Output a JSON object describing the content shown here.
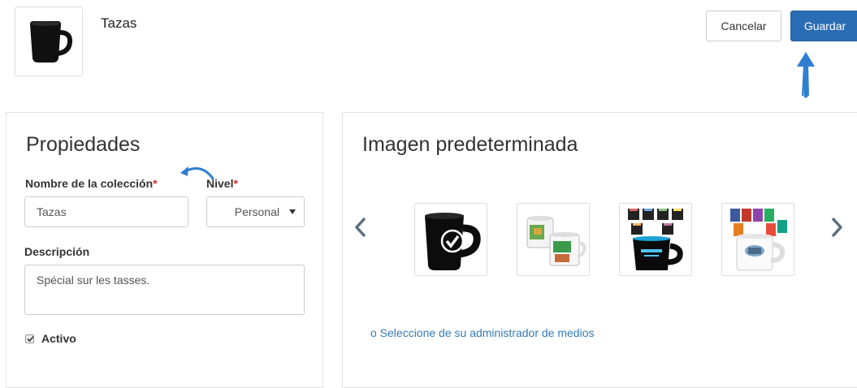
{
  "header": {
    "title": "Tazas",
    "thumbnail_icon": "black-mug-icon",
    "cancel_label": "Cancelar",
    "save_label": "Guardar"
  },
  "properties": {
    "heading": "Propiedades",
    "name_label": "Nombre de la colección",
    "name_value": "Tazas",
    "level_label": "Nivel",
    "level_value": "Personal",
    "required_marker": "*",
    "description_label": "Descripción",
    "description_value": "Spécial sur les tasses.",
    "active_label": "Activo",
    "active_checked": true
  },
  "default_image": {
    "heading": "Imagen predeterminada",
    "images": [
      {
        "icon": "black-mug-selected-icon",
        "selected": true
      },
      {
        "icon": "printed-mugs-icon",
        "selected": false
      },
      {
        "icon": "colored-mugs-stack-icon",
        "selected": false
      },
      {
        "icon": "assorted-mugs-icon",
        "selected": false
      }
    ],
    "media_link": "o Seleccione de su administrador de medios"
  },
  "colors": {
    "primary": "#2a6db4",
    "link": "#337ab7",
    "required": "#c9302c",
    "annotation": "#2f7fd1"
  }
}
